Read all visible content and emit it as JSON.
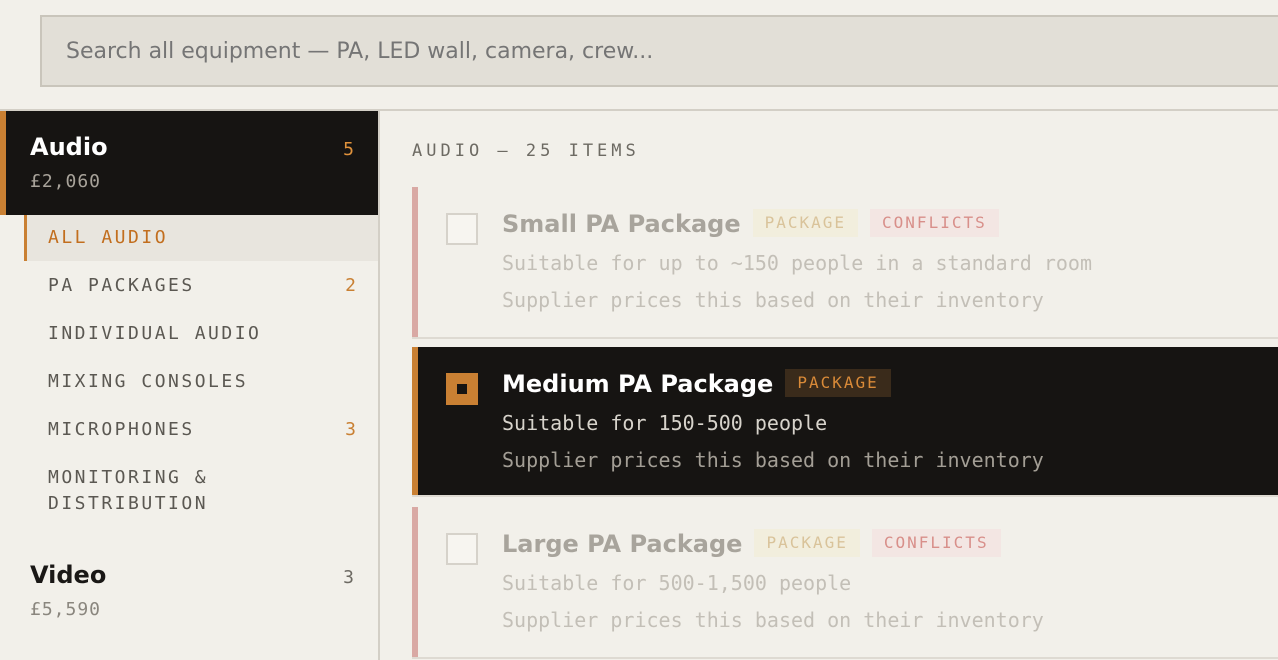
{
  "search": {
    "placeholder": "Search all equipment — PA, LED wall, camera, crew..."
  },
  "sidebar": {
    "categories": [
      {
        "name": "Audio",
        "price": "£2,060",
        "count": "5",
        "subitems": [
          {
            "label": "ALL AUDIO",
            "count": ""
          },
          {
            "label": "PA PACKAGES",
            "count": "2"
          },
          {
            "label": "INDIVIDUAL AUDIO",
            "count": ""
          },
          {
            "label": "MIXING CONSOLES",
            "count": ""
          },
          {
            "label": "MICROPHONES",
            "count": "3"
          },
          {
            "label": "MONITORING & DISTRIBUTION",
            "count": ""
          }
        ]
      },
      {
        "name": "Video",
        "price": "£5,590",
        "count": "3"
      }
    ]
  },
  "main": {
    "heading": "AUDIO — 25 ITEMS",
    "cards": [
      {
        "title": "Small PA Package",
        "tag": "PACKAGE",
        "conflict": "CONFLICTS",
        "desc": "Suitable for up to ~150 people in a standard room",
        "note": "Supplier prices this based on their inventory",
        "selected": false
      },
      {
        "title": "Medium PA Package",
        "tag": "PACKAGE",
        "conflict": "",
        "desc": "Suitable for 150-500 people",
        "note": "Supplier prices this based on their inventory",
        "selected": true
      },
      {
        "title": "Large PA Package",
        "tag": "PACKAGE",
        "conflict": "CONFLICTS",
        "desc": "Suitable for 500-1,500 people",
        "note": "Supplier prices this based on their inventory",
        "selected": false
      }
    ]
  },
  "colors": {
    "accent": "#c98033",
    "dark": "#161412",
    "background": "#f2f0ea",
    "conflict": "#d88f8a"
  }
}
